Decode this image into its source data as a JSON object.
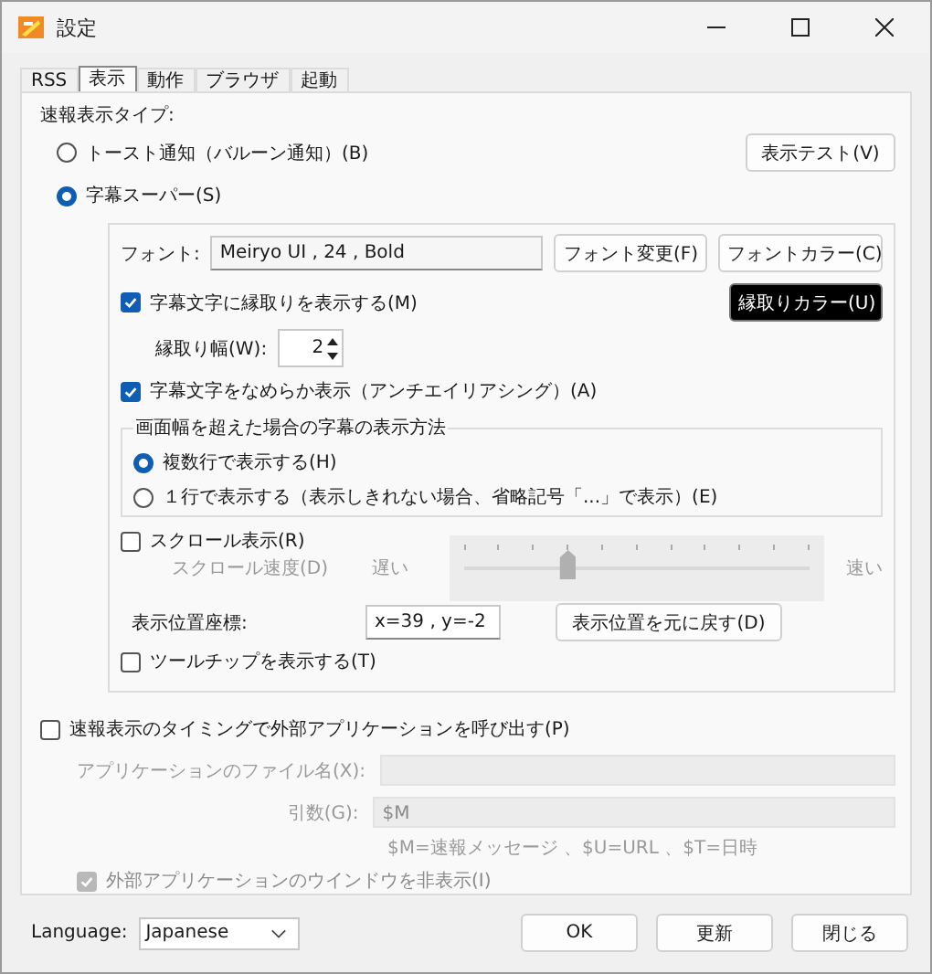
{
  "window": {
    "title": "設定"
  },
  "tabs": [
    {
      "label": "RSS",
      "selected": false
    },
    {
      "label": "表示",
      "selected": true
    },
    {
      "label": "動作",
      "selected": false
    },
    {
      "label": "ブラウザ",
      "selected": false
    },
    {
      "label": "起動",
      "selected": false
    }
  ],
  "display_type": {
    "label": "速報表示タイプ:",
    "options": [
      {
        "label": "トースト通知（バルーン通知）(B)",
        "selected": false
      },
      {
        "label": "字幕スーパー(S)",
        "selected": true
      }
    ],
    "test_button": "表示テスト(V)"
  },
  "subtitle": {
    "font_label": "フォント:",
    "font_value": "Meiryo UI , 24 , Bold",
    "font_change_button": "フォント変更(F)",
    "font_color_button": "フォントカラー(C)",
    "outline": {
      "label": "字幕文字に縁取りを表示する(M)",
      "checked": true
    },
    "outline_color_button": "縁取りカラー(U)",
    "outline_width": {
      "label": "縁取り幅(W):",
      "value": "2"
    },
    "antialias": {
      "label": "字幕文字をなめらか表示（アンチエイリアシング）(A)",
      "checked": true
    },
    "overflow": {
      "title": "画面幅を超えた場合の字幕の表示方法",
      "options": [
        {
          "label": "複数行で表示する(H)",
          "selected": true
        },
        {
          "label": "１行で表示する（表示しきれない場合、省略記号「...」で表示）(E)",
          "selected": false
        }
      ]
    },
    "scroll": {
      "label": "スクロール表示(R)",
      "checked": false
    },
    "scroll_speed": {
      "label": "スクロール速度(D)",
      "slow": "遅い",
      "fast": "速い",
      "level": 0.3,
      "disabled": true
    },
    "position": {
      "label": "表示位置座標:",
      "value": "x=39 , y=-2"
    },
    "reset_button": "表示位置を元に戻す(D)",
    "tooltip": {
      "label": "ツールチップを表示する(T)",
      "checked": false
    }
  },
  "external": {
    "label": "速報表示のタイミングで外部アプリケーションを呼び出す(P)",
    "checked": false,
    "file_label": "アプリケーションのファイル名(X):",
    "args_label": "引数(G):",
    "args_value": "$M",
    "hint": "$M=速報メッセージ 、$U=URL 、$T=日時",
    "hide_window": {
      "label": "外部アプリケーションのウインドウを非表示(I)",
      "checked": true,
      "disabled": true
    },
    "disabled": true
  },
  "language": {
    "label": "Language:",
    "value": "Japanese"
  },
  "buttons": [
    "OK",
    "更新",
    "閉じる"
  ]
}
